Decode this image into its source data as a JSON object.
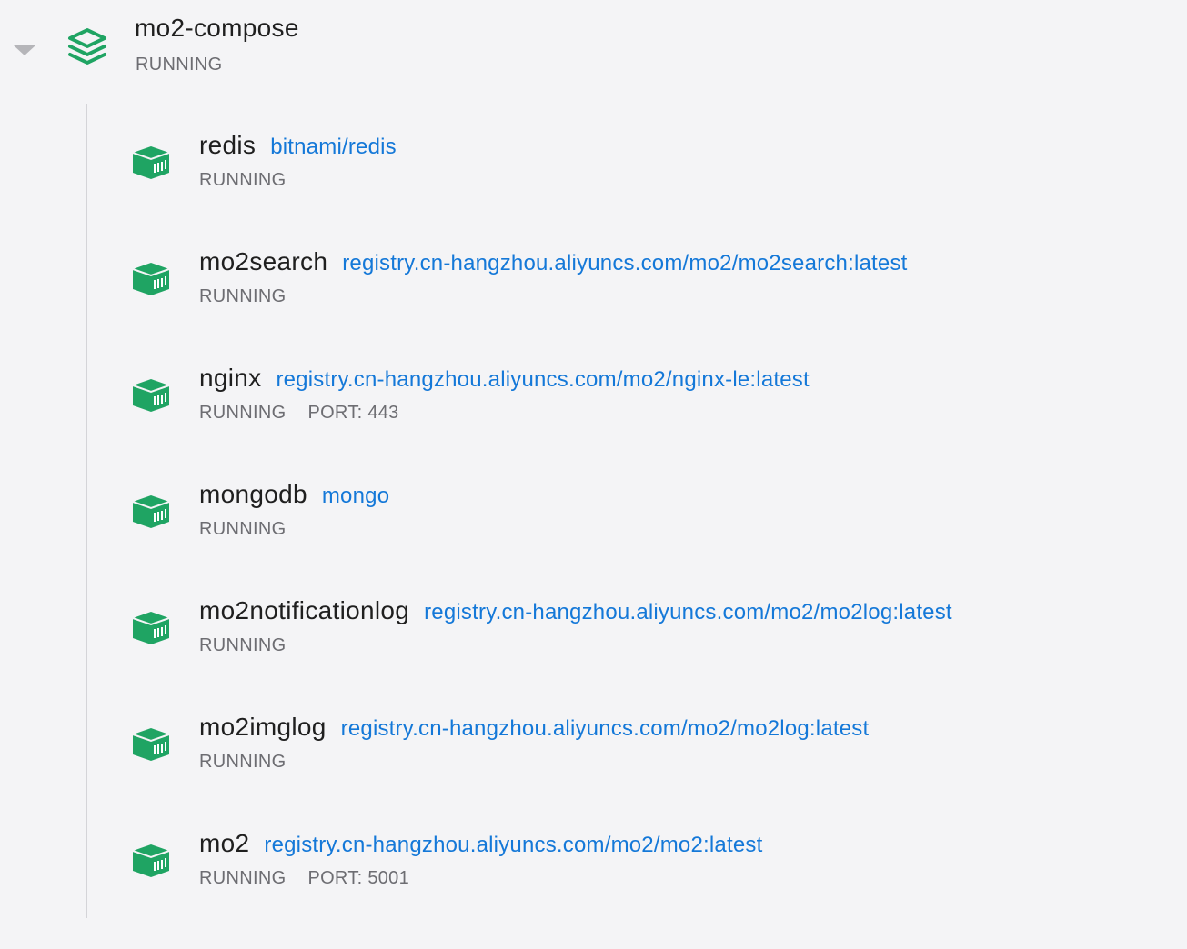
{
  "group": {
    "name": "mo2-compose",
    "status": "RUNNING",
    "icon": "stack-icon",
    "accent": "#1fa463"
  },
  "containers": [
    {
      "name": "redis",
      "image": "bitnami/redis",
      "status": "RUNNING",
      "port": ""
    },
    {
      "name": "mo2search",
      "image": "registry.cn-hangzhou.aliyuncs.com/mo2/mo2search:latest",
      "status": "RUNNING",
      "port": ""
    },
    {
      "name": "nginx",
      "image": "registry.cn-hangzhou.aliyuncs.com/mo2/nginx-le:latest",
      "status": "RUNNING",
      "port": "PORT: 443"
    },
    {
      "name": "mongodb",
      "image": "mongo",
      "status": "RUNNING",
      "port": ""
    },
    {
      "name": "mo2notificationlog",
      "image": "registry.cn-hangzhou.aliyuncs.com/mo2/mo2log:latest",
      "status": "RUNNING",
      "port": ""
    },
    {
      "name": "mo2imglog",
      "image": "registry.cn-hangzhou.aliyuncs.com/mo2/mo2log:latest",
      "status": "RUNNING",
      "port": ""
    },
    {
      "name": "mo2",
      "image": "registry.cn-hangzhou.aliyuncs.com/mo2/mo2:latest",
      "status": "RUNNING",
      "port": "PORT: 5001"
    }
  ],
  "colors": {
    "background": "#f4f4f6",
    "running_icon": "#1fa463",
    "image_link": "#1478d8",
    "status_text": "#6d6d72"
  }
}
